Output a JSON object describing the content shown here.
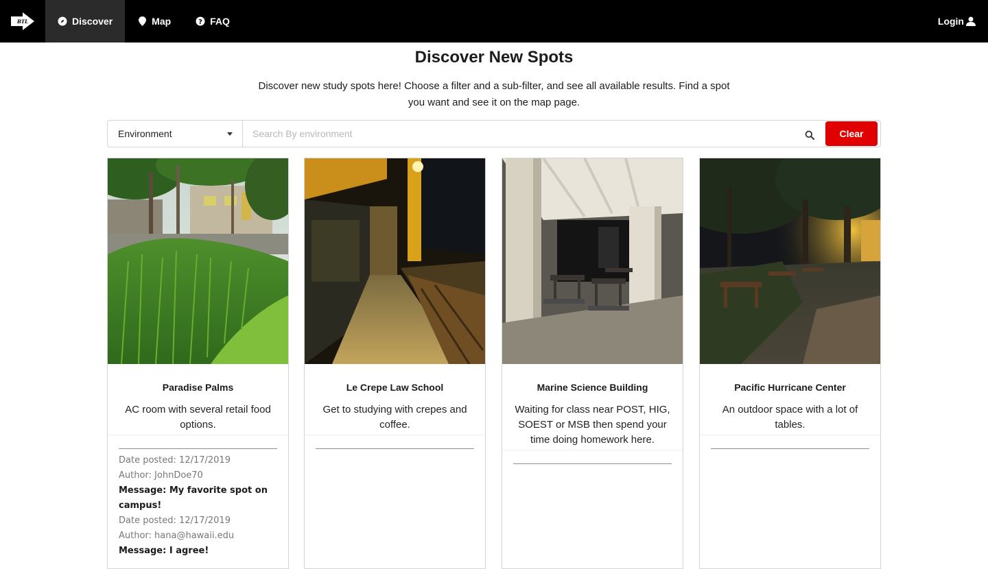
{
  "nav": {
    "brand_text": "BTL",
    "items": [
      {
        "label": "Discover",
        "icon": "compass-icon",
        "active": true
      },
      {
        "label": "Map",
        "icon": "map-pin-icon",
        "active": false
      },
      {
        "label": "FAQ",
        "icon": "question-circle-icon",
        "active": false
      }
    ],
    "login_label": "Login",
    "login_icon": "user-icon"
  },
  "page": {
    "title": "Discover New Spots",
    "description": "Discover new study spots here! Choose a filter and a sub-filter, and see all available results. Find a spot you want and see it on the map page."
  },
  "filter": {
    "selected": "Environment",
    "search_placeholder": "Search By environment",
    "search_value": "",
    "clear_label": "Clear",
    "clear_color": "#e00000"
  },
  "cards": [
    {
      "title": "Paradise Palms",
      "description": "AC room with several retail food options.",
      "comments": [
        {
          "date": "Date posted: 12/17/2019",
          "author": "Author: JohnDoe70",
          "message": "Message: My favorite spot on campus!"
        },
        {
          "date": "Date posted: 12/17/2019",
          "author": "Author: hana@hawaii.edu",
          "message": "Message: I agree!"
        }
      ]
    },
    {
      "title": "Le Crepe Law School",
      "description": "Get to studying with crepes and coffee.",
      "comments": []
    },
    {
      "title": "Marine Science Building",
      "description": "Waiting for class near POST, HIG, SOEST or MSB then spend your time doing homework here.",
      "comments": []
    },
    {
      "title": "Pacific Hurricane Center",
      "description": "An outdoor space with a lot of tables.",
      "comments": []
    }
  ]
}
